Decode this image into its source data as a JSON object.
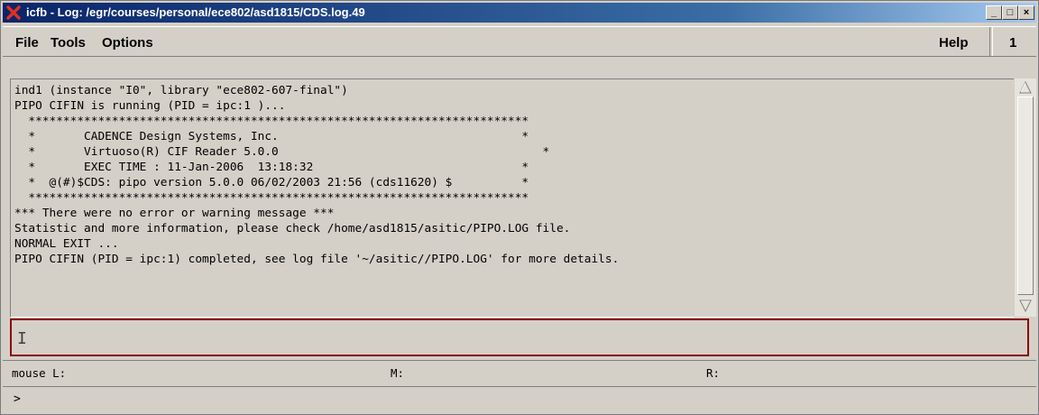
{
  "window": {
    "title": "icfb - Log: /egr/courses/personal/ece802/asd1815/CDS.log.49",
    "minimize_label": "_",
    "maximize_label": "□",
    "close_label": "×"
  },
  "menu": {
    "file": "File",
    "tools": "Tools",
    "options": "Options",
    "help": "Help",
    "window_number": "1"
  },
  "log": {
    "lines": [
      "ind1 (instance \"I0\", library \"ece802-607-final\")",
      "PIPO CIFIN is running (PID = ipc:1 )...",
      "  ************************************************************************",
      "  *       CADENCE Design Systems, Inc.                                   *",
      "  *       Virtuoso(R) CIF Reader 5.0.0                                      *",
      "  *       EXEC TIME : 11-Jan-2006  13:18:32                              *",
      "  *  @(#)$CDS: pipo version 5.0.0 06/02/2003 21:56 (cds11620) $          *",
      "  ************************************************************************",
      "*** There were no error or warning message ***",
      "Statistic and more information, please check /home/asd1815/asitic/PIPO.LOG file.",
      "NORMAL EXIT ...",
      "PIPO CIFIN (PID = ipc:1) completed, see log file '~/asitic//PIPO.LOG' for more details."
    ]
  },
  "input": {
    "value": ""
  },
  "mouse": {
    "left_label": "mouse L:",
    "middle_label": "M:",
    "right_label": "R:"
  },
  "prompt": {
    "symbol": ">"
  }
}
